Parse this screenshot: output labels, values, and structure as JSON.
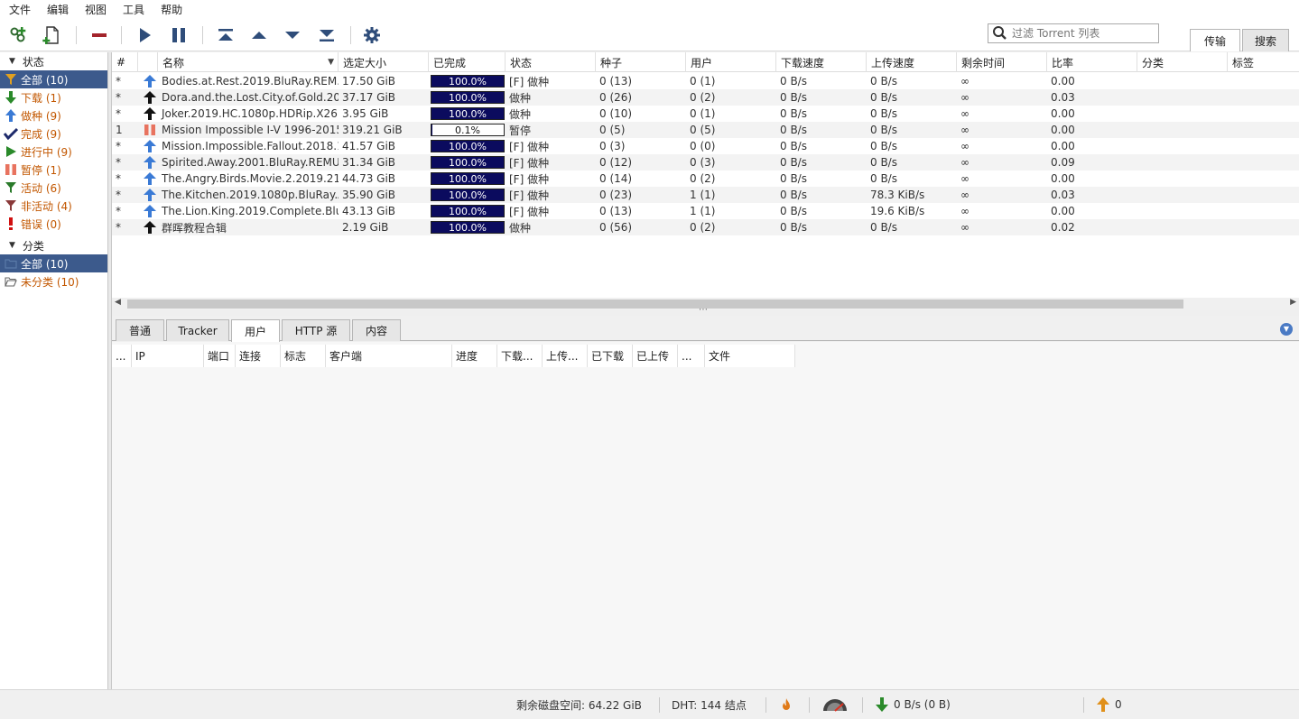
{
  "menu": [
    "文件",
    "编辑",
    "视图",
    "工具",
    "帮助"
  ],
  "toolbar": {
    "filter_placeholder": "过滤 Torrent 列表",
    "tabs": [
      "传输",
      "搜索"
    ]
  },
  "sidebar": {
    "status_header": "状态",
    "status_items": [
      {
        "label": "全部 (10)",
        "icon": "filter-icon",
        "selected": true
      },
      {
        "label": "下载 (1)",
        "icon": "download-arrow-icon"
      },
      {
        "label": "做种 (9)",
        "icon": "upload-arrow-icon"
      },
      {
        "label": "完成 (9)",
        "icon": "checkmark-icon"
      },
      {
        "label": "进行中 (9)",
        "icon": "play-icon"
      },
      {
        "label": "暂停 (1)",
        "icon": "pause-icon"
      },
      {
        "label": "活动 (6)",
        "icon": "filter-active-icon"
      },
      {
        "label": "非活动 (4)",
        "icon": "filter-inactive-icon"
      },
      {
        "label": "错误 (0)",
        "icon": "error-icon"
      }
    ],
    "category_header": "分类",
    "category_items": [
      {
        "label": "全部 (10)",
        "icon": "folder-icon",
        "selected": true
      },
      {
        "label": "未分类 (10)",
        "icon": "folder-open-icon"
      }
    ]
  },
  "torrent_columns": [
    "#",
    "",
    "名称",
    "选定大小",
    "已完成",
    "状态",
    "种子",
    "用户",
    "下载速度",
    "上传速度",
    "剩余时间",
    "比率",
    "分类",
    "标签"
  ],
  "torrents": [
    {
      "num": "*",
      "icon": "upload-blue",
      "name": "Bodies.at.Rest.2019.BluRay.REM...",
      "size": "17.50 GiB",
      "progress": 100,
      "progress_text": "100.0%",
      "state": "[F] 做种",
      "seeds": "0 (13)",
      "peers": "0 (1)",
      "down": "0 B/s",
      "up": "0 B/s",
      "eta": "∞",
      "ratio": "0.00"
    },
    {
      "num": "*",
      "icon": "upload-black",
      "name": "Dora.and.the.Lost.City.of.Gold.201...",
      "size": "37.17 GiB",
      "progress": 100,
      "progress_text": "100.0%",
      "state": "做种",
      "seeds": "0 (26)",
      "peers": "0 (2)",
      "down": "0 B/s",
      "up": "0 B/s",
      "eta": "∞",
      "ratio": "0.03"
    },
    {
      "num": "*",
      "icon": "upload-black",
      "name": "Joker.2019.HC.1080p.HDRip.X26...",
      "size": "3.95 GiB",
      "progress": 100,
      "progress_text": "100.0%",
      "state": "做种",
      "seeds": "0 (10)",
      "peers": "0 (1)",
      "down": "0 B/s",
      "up": "0 B/s",
      "eta": "∞",
      "ratio": "0.00"
    },
    {
      "num": "1",
      "icon": "pause-red",
      "name": "Mission Impossible I-V 1996-2015...",
      "size": "319.21 GiB",
      "progress": 0.1,
      "progress_text": "0.1%",
      "state": "暂停",
      "seeds": "0 (5)",
      "peers": "0 (5)",
      "down": "0 B/s",
      "up": "0 B/s",
      "eta": "∞",
      "ratio": "0.00"
    },
    {
      "num": "*",
      "icon": "upload-blue",
      "name": "Mission.Impossible.Fallout.2018.1...",
      "size": "41.57 GiB",
      "progress": 100,
      "progress_text": "100.0%",
      "state": "[F] 做种",
      "seeds": "0 (3)",
      "peers": "0 (0)",
      "down": "0 B/s",
      "up": "0 B/s",
      "eta": "∞",
      "ratio": "0.00"
    },
    {
      "num": "*",
      "icon": "upload-blue",
      "name": "Spirited.Away.2001.BluRay.REMU...",
      "size": "31.34 GiB",
      "progress": 100,
      "progress_text": "100.0%",
      "state": "[F] 做种",
      "seeds": "0 (12)",
      "peers": "0 (3)",
      "down": "0 B/s",
      "up": "0 B/s",
      "eta": "∞",
      "ratio": "0.09"
    },
    {
      "num": "*",
      "icon": "upload-blue",
      "name": "The.Angry.Birds.Movie.2.2019.216...",
      "size": "44.73 GiB",
      "progress": 100,
      "progress_text": "100.0%",
      "state": "[F] 做种",
      "seeds": "0 (14)",
      "peers": "0 (2)",
      "down": "0 B/s",
      "up": "0 B/s",
      "eta": "∞",
      "ratio": "0.00"
    },
    {
      "num": "*",
      "icon": "upload-blue",
      "name": "The.Kitchen.2019.1080p.BluRay.A...",
      "size": "35.90 GiB",
      "progress": 100,
      "progress_text": "100.0%",
      "state": "[F] 做种",
      "seeds": "0 (23)",
      "peers": "1 (1)",
      "down": "0 B/s",
      "up": "78.3 KiB/s",
      "eta": "∞",
      "ratio": "0.03"
    },
    {
      "num": "*",
      "icon": "upload-blue",
      "name": "The.Lion.King.2019.Complete.Blur...",
      "size": "43.13 GiB",
      "progress": 100,
      "progress_text": "100.0%",
      "state": "[F] 做种",
      "seeds": "0 (13)",
      "peers": "1 (1)",
      "down": "0 B/s",
      "up": "19.6 KiB/s",
      "eta": "∞",
      "ratio": "0.00"
    },
    {
      "num": "*",
      "icon": "upload-black",
      "name": "群晖教程合辑",
      "size": "2.19 GiB",
      "progress": 100,
      "progress_text": "100.0%",
      "state": "做种",
      "seeds": "0 (56)",
      "peers": "0 (2)",
      "down": "0 B/s",
      "up": "0 B/s",
      "eta": "∞",
      "ratio": "0.02"
    }
  ],
  "detail_tabs": [
    "普通",
    "Tracker",
    "用户",
    "HTTP 源",
    "内容"
  ],
  "peer_columns": [
    "...",
    "IP",
    "端口",
    "连接",
    "标志",
    "客户端",
    "进度",
    "下载...",
    "上传...",
    "已下载",
    "已上传",
    "...",
    "文件"
  ],
  "statusbar": {
    "disk": "剩余磁盘空间: 64.22 GiB",
    "dht": "DHT: 144 结点",
    "download": "0 B/s (0 B)",
    "upload": "0"
  },
  "colors": {
    "selection": "#3c5a8c",
    "progress_fill": "#0b0b5e",
    "sidebar_text": "#c25700",
    "upload_blue": "#3a7ad5",
    "pause_red": "#e8735f"
  }
}
